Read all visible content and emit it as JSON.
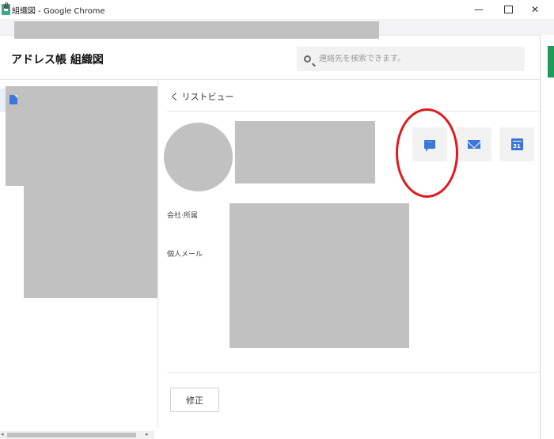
{
  "window": {
    "title": "組織図 - Google Chrome",
    "minimize_glyph": "—",
    "close_glyph": "✕"
  },
  "header": {
    "title": "アドレス帳 組織図",
    "search": {
      "placeholder": "連絡先を検索できます。",
      "value": ""
    }
  },
  "detail": {
    "back_link": "く リストビュー",
    "actions": [
      {
        "name": "chat",
        "icon": "chat-bubble-icon"
      },
      {
        "name": "mail",
        "icon": "mail-icon"
      },
      {
        "name": "calendar",
        "icon": "calendar-icon",
        "text": "31"
      }
    ],
    "fields": [
      {
        "label": "会社·所属"
      },
      {
        "label": "個人メール"
      }
    ],
    "edit_button": "修正"
  },
  "colors": {
    "accent": "#3c77d8",
    "highlight_circle": "#e01a1f",
    "redaction": "#c1c1c1"
  }
}
